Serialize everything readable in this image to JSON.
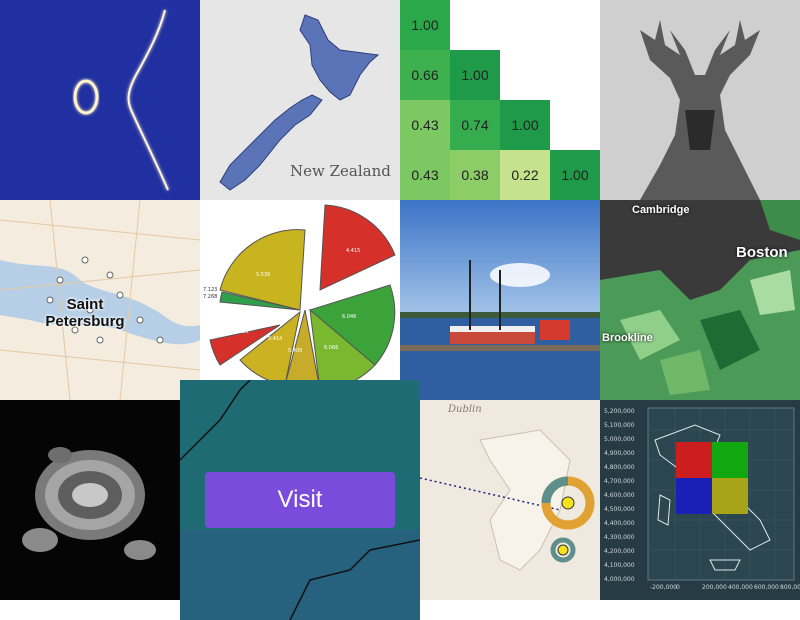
{
  "tiles": {
    "nz_label": "New Zealand",
    "matrix": [
      [
        "1.00"
      ],
      [
        "0.66",
        "1.00"
      ],
      [
        "0.43",
        "0.74",
        "1.00"
      ],
      [
        "0.43",
        "0.38",
        "0.22",
        "1.00"
      ]
    ],
    "matrix_colors": [
      [
        "#2aa84a"
      ],
      [
        "#3cb14e",
        "#1e9a48"
      ],
      [
        "#7cc862",
        "#35ad4e",
        "#1e9a48"
      ],
      [
        "#7cc862",
        "#8ccd68",
        "#c5e38c",
        "#1e9a48"
      ]
    ],
    "spb_label_1": "Saint",
    "spb_label_2": "Petersburg",
    "pie_labels": [
      "4.415",
      "5.539",
      "6.046",
      "6.066",
      "5.400",
      "5.414",
      "4.423",
      "5.566",
      "7.268",
      "7.123"
    ],
    "boston_labels": {
      "cambridge": "Cambridge",
      "boston": "Boston",
      "brookline": "Brookline"
    },
    "visit_button": "Visit",
    "dublin_label": "Dublin",
    "italy_y_ticks": [
      "5,200,000",
      "5,100,000",
      "5,000,000",
      "4,900,000",
      "4,800,000",
      "4,700,000",
      "4,600,000",
      "4,500,000",
      "4,400,000",
      "4,300,000",
      "4,200,000",
      "4,100,000",
      "4,000,000"
    ],
    "italy_x_ticks": [
      "-200,000",
      "0",
      "200,000",
      "400,000",
      "600,000",
      "800,000"
    ]
  }
}
